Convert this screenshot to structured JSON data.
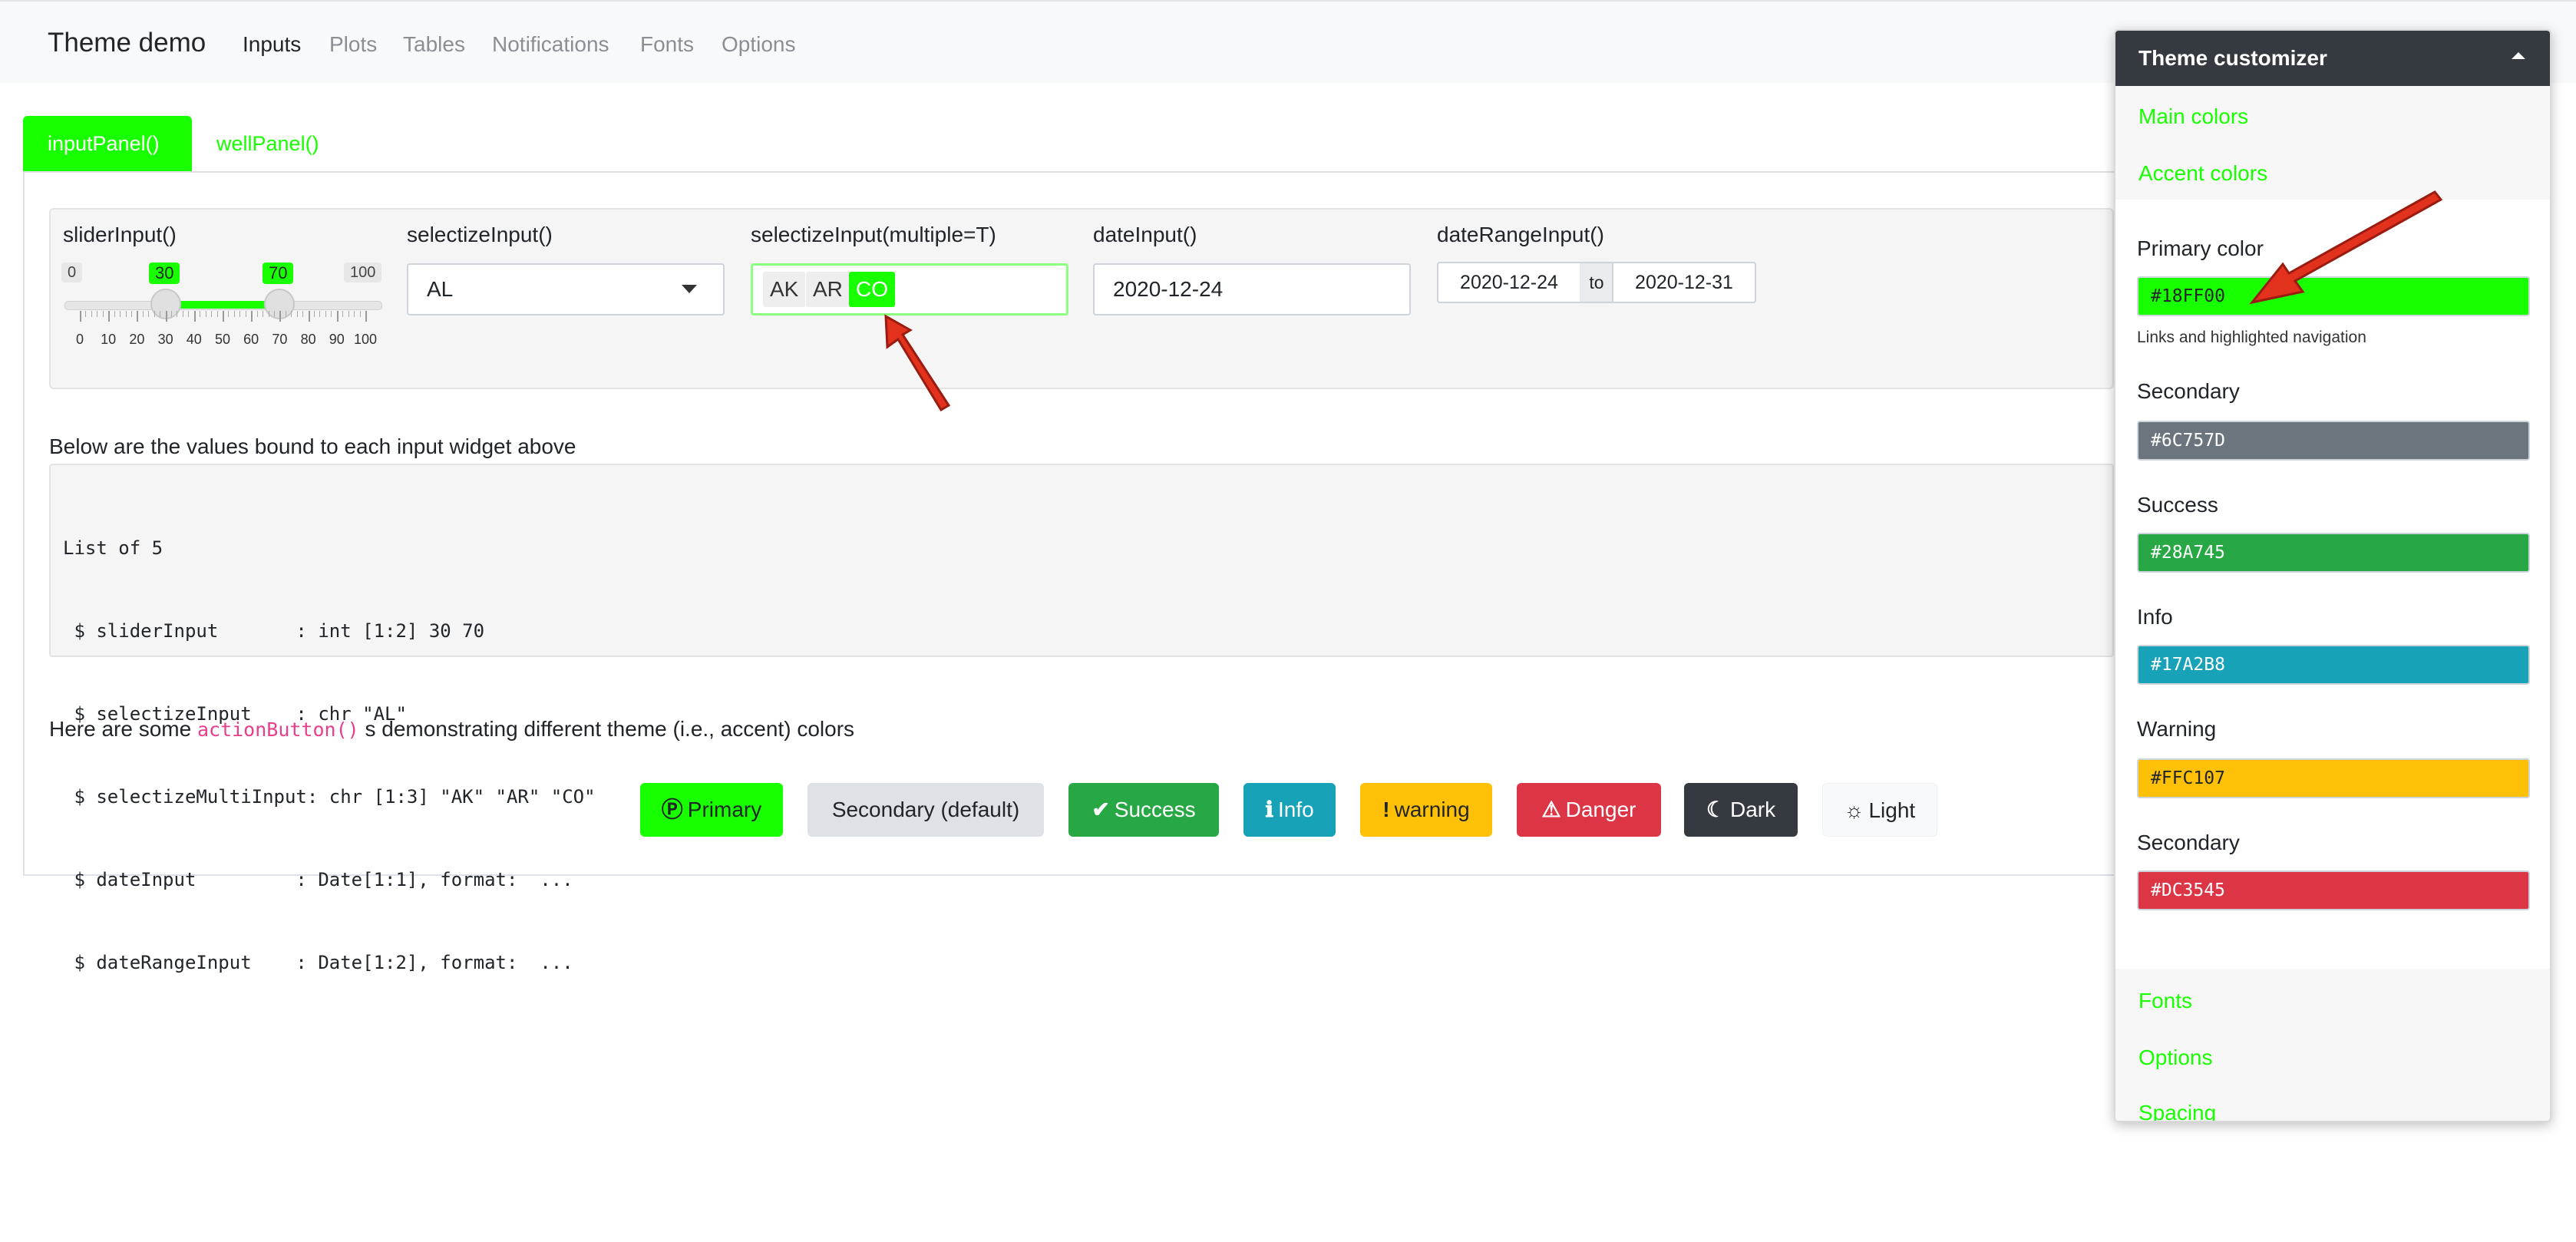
{
  "navbar": {
    "brand": "Theme demo",
    "items": [
      "Inputs",
      "Plots",
      "Tables",
      "Notifications",
      "Fonts",
      "Options"
    ]
  },
  "tabs": [
    "inputPanel()",
    "wellPanel()"
  ],
  "inputs": {
    "slider": {
      "label": "sliderInput()",
      "min": "0",
      "max": "100",
      "from": "30",
      "to": "70",
      "from_value": 30,
      "to_value": 70,
      "ticks": [
        "0",
        "10",
        "20",
        "30",
        "40",
        "50",
        "60",
        "70",
        "80",
        "90",
        "100"
      ]
    },
    "selectize": {
      "label": "selectizeInput()",
      "value": "AL"
    },
    "selectize_multi": {
      "label": "selectizeInput(multiple=T)",
      "chips": [
        "AK",
        "AR",
        "CO"
      ]
    },
    "date": {
      "label": "dateInput()",
      "value": "2020-12-24"
    },
    "date_range": {
      "label": "dateRangeInput()",
      "start": "2020-12-24",
      "sep": "to",
      "end": "2020-12-31"
    }
  },
  "values_title": "Below are the values bound to each input widget above",
  "values_lines": [
    "List of 5",
    " $ sliderInput       : int [1:2] 30 70",
    " $ selectizeInput    : chr \"AL\"",
    " $ selectizeMultiInput: chr [1:3] \"AK\" \"AR\" \"CO\"",
    " $ dateInput         : Date[1:1], format:  ...",
    " $ dateRangeInput    : Date[1:2], format:  ..."
  ],
  "demo": {
    "prefix": "Here are some ",
    "code": "actionButton()",
    "suffix": " s demonstrating different theme (i.e., accent) colors"
  },
  "buttons": [
    {
      "label": "Primary",
      "icon": "Ⓟ",
      "icon_name": "p-circle-icon",
      "bg": "#18FF00",
      "fg": "#212529"
    },
    {
      "label": "Secondary (default)",
      "icon": "",
      "icon_name": "",
      "bg": "#dee2e6",
      "fg": "#212529"
    },
    {
      "label": "Success",
      "icon": "✔",
      "icon_name": "check-icon",
      "bg": "#28A745",
      "fg": "#ffffff"
    },
    {
      "label": "Info",
      "icon": "ℹ",
      "icon_name": "info-icon",
      "bg": "#17A2B8",
      "fg": "#ffffff"
    },
    {
      "label": "warning",
      "icon": "!",
      "icon_name": "exclamation-icon",
      "bg": "#FFC107",
      "fg": "#212529"
    },
    {
      "label": "Danger",
      "icon": "⚠",
      "icon_name": "warning-triangle-icon",
      "bg": "#DC3545",
      "fg": "#ffffff"
    },
    {
      "label": "Dark",
      "icon": "☾",
      "icon_name": "moon-icon",
      "bg": "#343A40",
      "fg": "#ffffff"
    },
    {
      "label": "Light",
      "icon": "☼",
      "icon_name": "sun-icon",
      "bg": "#f8f9fa",
      "fg": "#212529"
    }
  ],
  "customizer": {
    "title": "Theme customizer",
    "sections_top": [
      "Main colors",
      "Accent colors"
    ],
    "fields": [
      {
        "label": "Primary color",
        "value": "#18FF00",
        "bg": "#18FF00",
        "fg": "#212529"
      },
      {
        "label": "Secondary",
        "value": "#6C757D",
        "bg": "#6C757D",
        "fg": "#ffffff"
      },
      {
        "label": "Success",
        "value": "#28A745",
        "bg": "#28A745",
        "fg": "#ffffff"
      },
      {
        "label": "Info",
        "value": "#17A2B8",
        "bg": "#17A2B8",
        "fg": "#ffffff"
      },
      {
        "label": "Warning",
        "value": "#FFC107",
        "bg": "#FFC107",
        "fg": "#212529"
      },
      {
        "label": "Secondary",
        "value": "#DC3545",
        "bg": "#DC3545",
        "fg": "#ffffff"
      }
    ],
    "primary_help": "Links and highlighted navigation",
    "sections_bottom": [
      "Fonts",
      "Options",
      "Spacing"
    ]
  },
  "colors": {
    "accent": "#18FF00",
    "annotation_arrow": "#E2311D"
  }
}
